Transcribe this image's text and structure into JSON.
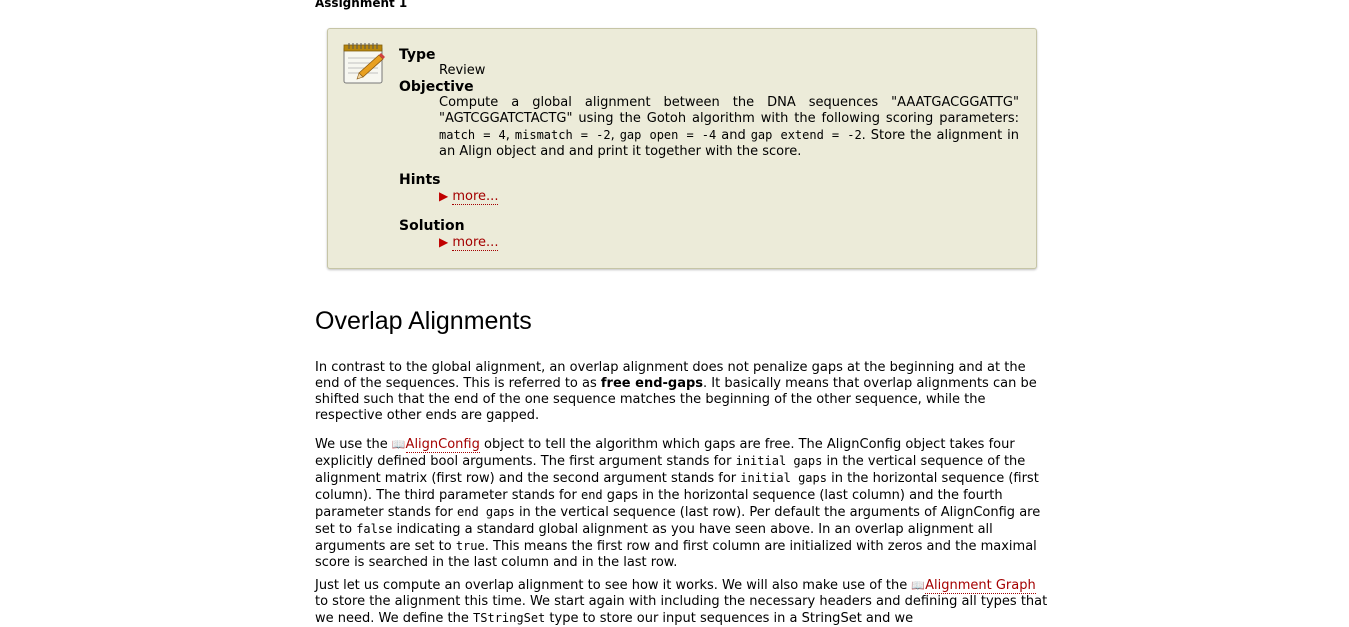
{
  "assignment": {
    "title": "Assignment 1",
    "type_label": "Type",
    "type_value": "Review",
    "objective_label": "Objective",
    "objective": {
      "part1": "Compute a global alignment between the DNA sequences \"AAATGACGGATTG\" \"AGTCGGATCTACTG\" using the Gotoh algorithm with the following scoring parameters: ",
      "code1": "match = 4",
      "sep1": ", ",
      "code2": "mismatch = -2",
      "sep2": ", ",
      "code3": "gap open = -4",
      "sep3": " and ",
      "code4": "gap extend = -2",
      "part2": ". Store the alignment in an Align object and and print it together with the score."
    },
    "hints_label": "Hints",
    "hints_more": "more...",
    "solution_label": "Solution",
    "solution_more": "more..."
  },
  "section": {
    "heading": "Overlap Alignments"
  },
  "para1": {
    "t1": "In contrast to the global alignment, an overlap alignment does not penalize gaps at the beginning and at the end of the sequences. This is referred to as ",
    "bold": "free end-gaps",
    "t2": ". It basically means that overlap alignments can be shifted such that the end of the one sequence matches the beginning of the other sequence, while the respective other ends are gapped."
  },
  "para2": {
    "t1": "We use the ",
    "link": "AlignConfig",
    "t2": " object to tell the algorithm which gaps are free. The AlignConfig object takes four explicitly defined bool arguments. The first argument stands for ",
    "c1": "initial gaps",
    "t3": " in the vertical sequence of the alignment matrix (first row) and the second argument stands for ",
    "c2": "initial gaps",
    "t4": " in the horizontal sequence (first column). The third parameter stands for ",
    "c3": "end",
    "t5": " gaps in the horizontal sequence (last column) and the fourth parameter stands for ",
    "c4": "end gaps",
    "t6": " in the vertical sequence (last row). Per default the arguments of AlignConfig are set to ",
    "c5": "false",
    "t7": " indicating a standard global alignment as you have seen above. In an overlap alignment all arguments are set to ",
    "c6": "true",
    "t8": ". This means the first row and first column are initialized with zeros and the maximal score is searched in the last column and in the last row."
  },
  "para3": {
    "t1": "Just let us compute an overlap alignment to see how it works. We will also make use of the ",
    "link": "Alignment Graph",
    "t2": " to store the alignment this time. We start again with including the necessary headers and defining all types that we need. We define the ",
    "c1": "TStringSet",
    "t3": " type to store our input sequences in a StringSet and we"
  },
  "icons": {
    "assignment": "notepad-pencil-icon",
    "more": "triangle-right-icon",
    "doc_link": "book-icon"
  },
  "colors": {
    "box_bg": "#ecebd9",
    "link": "#a40000"
  }
}
